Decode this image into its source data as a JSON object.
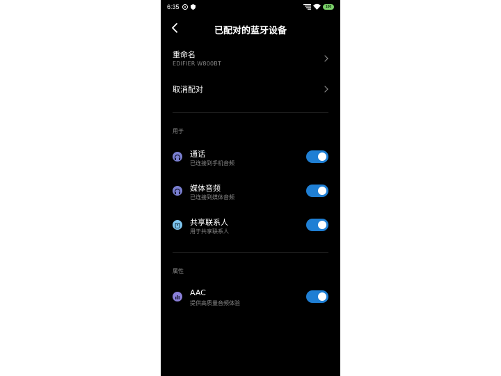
{
  "status_bar": {
    "time": "6:35",
    "battery": "100"
  },
  "header": {
    "title": "已配对的蓝牙设备",
    "back_icon": "chevron-left-icon"
  },
  "rename": {
    "title": "重命名",
    "device_name": "EDIFIER W800BT"
  },
  "unpair": {
    "title": "取消配对"
  },
  "use_section": {
    "header": "用于",
    "items": [
      {
        "title": "通话",
        "subtitle": "已连接到手机音频",
        "icon": "headset-icon",
        "icon_color": "#7a7fd0",
        "enabled": true
      },
      {
        "title": "媒体音频",
        "subtitle": "已连接到媒体音频",
        "icon": "headphones-icon",
        "icon_color": "#7a7fd0",
        "enabled": true
      },
      {
        "title": "共享联系人",
        "subtitle": "用于共享联系人",
        "icon": "contact-icon",
        "icon_color": "#7fc6f0",
        "enabled": true
      }
    ]
  },
  "properties_section": {
    "header": "属性",
    "items": [
      {
        "title": "AAC",
        "subtitle": "提供高质量音频体验",
        "icon": "audio-quality-icon",
        "icon_color": "#8a7fd8",
        "enabled": true
      }
    ]
  },
  "colors": {
    "background": "#000000",
    "toggle_on": "#1f7fd4",
    "subtitle": "#8a8a8a"
  }
}
